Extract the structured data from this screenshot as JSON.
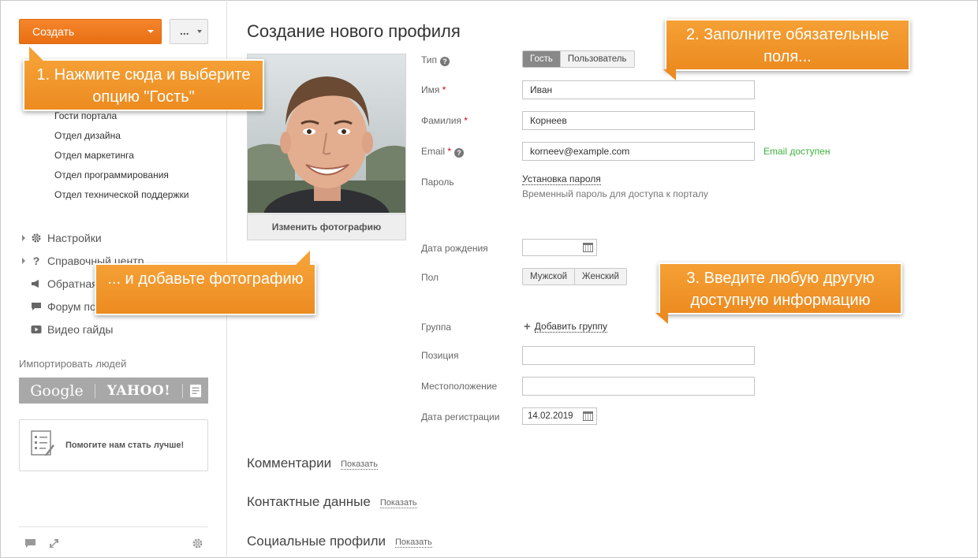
{
  "sidebar": {
    "create_label": "Создать",
    "more_label": "...",
    "departments": [
      "Гости портала",
      "Отдел дизайна",
      "Отдел маркетинга",
      "Отдел программирования",
      "Отдел технической поддержки"
    ],
    "nav": [
      {
        "label": "Настройки",
        "icon": "gear-icon",
        "expandable": true
      },
      {
        "label": "Справочный центр",
        "icon": "question-icon",
        "expandable": true
      },
      {
        "label": "Обратная связь",
        "icon": "megaphone-icon",
        "expandable": false
      },
      {
        "label": "Форум поддержки",
        "icon": "chat-icon",
        "expandable": false
      },
      {
        "label": "Видео гайды",
        "icon": "play-icon",
        "expandable": false
      }
    ],
    "import_title": "Импортировать людей",
    "import_google": "Google",
    "import_yahoo": "YAHOO!",
    "help_label": "Помогите нам стать лучше!"
  },
  "main": {
    "title": "Создание нового профиля",
    "change_photo": "Изменить фотографию",
    "form": {
      "type_label": "Тип",
      "type_options": [
        "Гость",
        "Пользователь"
      ],
      "type_selected": "Гость",
      "first_name_label": "Имя",
      "first_name_value": "Иван",
      "last_name_label": "Фамилия",
      "last_name_value": "Корнеев",
      "email_label": "Email",
      "email_value": "korneev@example.com",
      "email_status": "Email доступен",
      "password_label": "Пароль",
      "password_link": "Установка пароля",
      "password_hint": "Временный пароль для доступа к порталу",
      "birthdate_label": "Дата рождения",
      "birthdate_value": "",
      "gender_label": "Пол",
      "gender_options": [
        "Мужской",
        "Женский"
      ],
      "group_label": "Группа",
      "group_add": "Добавить группу",
      "position_label": "Позиция",
      "position_value": "",
      "location_label": "Местоположение",
      "location_value": "",
      "regdate_label": "Дата регистрации",
      "regdate_value": "14.02.2019"
    },
    "sections": [
      {
        "title": "Комментарии",
        "action": "Показать"
      },
      {
        "title": "Контактные данные",
        "action": "Показать"
      },
      {
        "title": "Социальные профили",
        "action": "Показать"
      }
    ]
  },
  "callouts": {
    "c1": "1. Нажмите сюда и выберите опцию \"Гость\"",
    "c2": "2. Заполните обязательные поля...",
    "c3": "3. Введите любую другую доступную информацию",
    "c4": "... и добавьте фотографию"
  },
  "colors": {
    "accent": "#f47b20",
    "callout": "#f0942a",
    "success": "#3db33d",
    "required": "#d0021b"
  }
}
